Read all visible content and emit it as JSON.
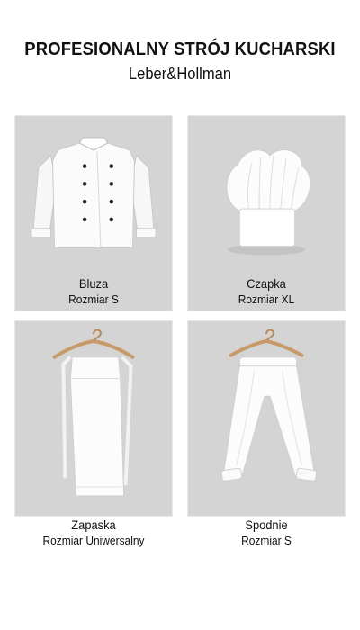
{
  "header": {
    "title": "PROFESIONALNY STRÓJ KUCHARSKI",
    "brand": "Leber&Hollman"
  },
  "items": [
    {
      "name": "Bluza",
      "size": "Rozmiar S",
      "icon": "chef-jacket-icon"
    },
    {
      "name": "Czapka",
      "size": "Rozmiar XL",
      "icon": "chef-hat-icon"
    },
    {
      "name": "Zapaska",
      "size": "Rozmiar Uniwersalny",
      "icon": "apron-icon"
    },
    {
      "name": "Spodnie",
      "size": "Rozmiar S",
      "icon": "chef-pants-icon"
    }
  ],
  "colors": {
    "panel": "#d4d4d4",
    "garment": "#ffffff",
    "buttons": "#222222"
  }
}
